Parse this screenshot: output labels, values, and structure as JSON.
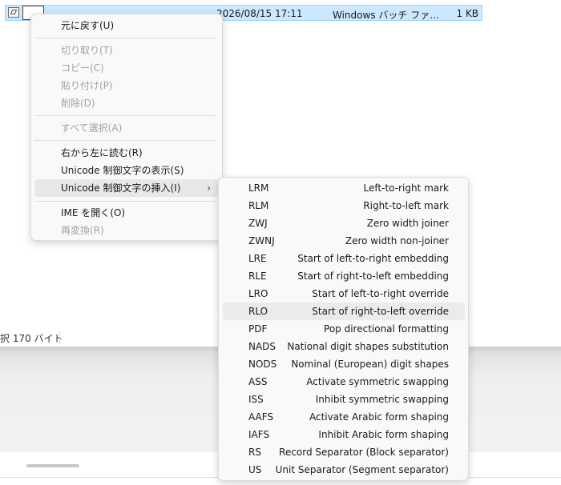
{
  "file": {
    "date": "2026/08/15 17:11",
    "type": "Windows バッチ ファ...",
    "size": "1 KB"
  },
  "status": {
    "text": "択  170 バイト"
  },
  "context_menu": {
    "items": [
      {
        "label": "元に戻す(U)",
        "enabled": true
      },
      {
        "label": "切り取り(T)",
        "enabled": false
      },
      {
        "label": "コピー(C)",
        "enabled": false
      },
      {
        "label": "貼り付け(P)",
        "enabled": false
      },
      {
        "label": "削除(D)",
        "enabled": false
      },
      {
        "label": "すべて選択(A)",
        "enabled": false
      },
      {
        "label": "右から左に読む(R)",
        "enabled": true
      },
      {
        "label": "Unicode 制御文字の表示(S)",
        "enabled": true
      },
      {
        "label": "Unicode 制御文字の挿入(I)",
        "enabled": true,
        "has_submenu": true,
        "arrow": "›"
      },
      {
        "label": "IME を開く(O)",
        "enabled": true
      },
      {
        "label": "再変換(R)",
        "enabled": false
      }
    ]
  },
  "submenu": {
    "items": [
      {
        "code": "LRM",
        "desc": "Left-to-right mark"
      },
      {
        "code": "RLM",
        "desc": "Right-to-left mark"
      },
      {
        "code": "ZWJ",
        "desc": "Zero width joiner"
      },
      {
        "code": "ZWNJ",
        "desc": "Zero width non-joiner"
      },
      {
        "code": "LRE",
        "desc": "Start of left-to-right embedding"
      },
      {
        "code": "RLE",
        "desc": "Start of right-to-left embedding"
      },
      {
        "code": "LRO",
        "desc": "Start of left-to-right override"
      },
      {
        "code": "RLO",
        "desc": "Start of right-to-left override"
      },
      {
        "code": "PDF",
        "desc": "Pop directional formatting"
      },
      {
        "code": "NADS",
        "desc": "National digit shapes substitution"
      },
      {
        "code": "NODS",
        "desc": "Nominal (European) digit shapes"
      },
      {
        "code": "ASS",
        "desc": "Activate symmetric swapping"
      },
      {
        "code": "ISS",
        "desc": "Inhibit symmetric swapping"
      },
      {
        "code": "AAFS",
        "desc": "Activate Arabic form shaping"
      },
      {
        "code": "IAFS",
        "desc": "Inhibit Arabic form shaping"
      },
      {
        "code": "RS",
        "desc": "Record Separator (Block separator)"
      },
      {
        "code": "US",
        "desc": "Unit Separator (Segment separator)"
      }
    ]
  }
}
